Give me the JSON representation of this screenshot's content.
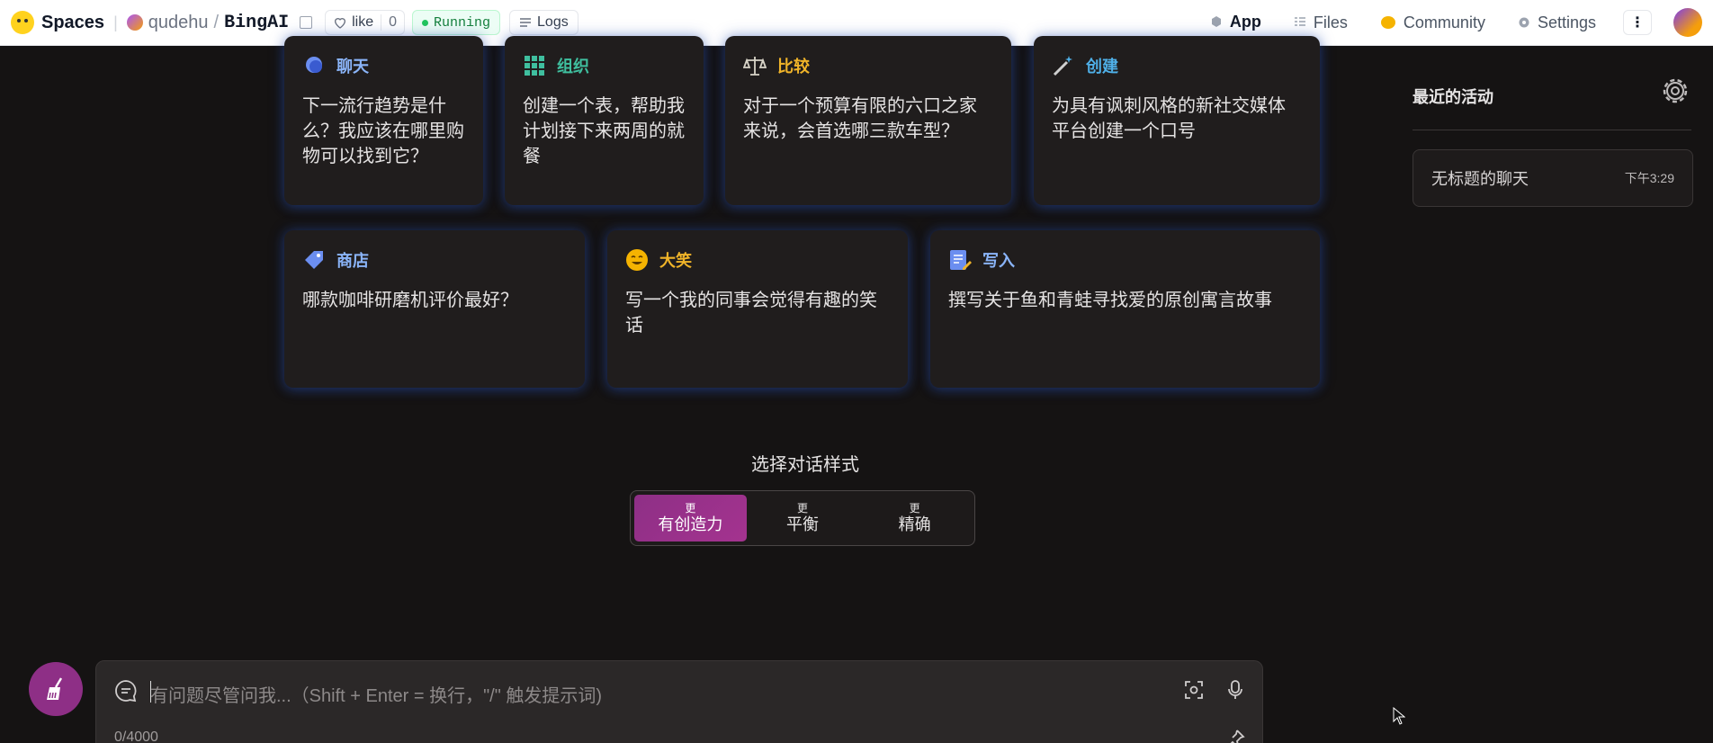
{
  "topbar": {
    "brand": "Spaces",
    "owner": "qudehu",
    "slash": "/",
    "repo": "BingAI",
    "like_label": "like",
    "like_count": "0",
    "status": "Running",
    "logs_label": "Logs",
    "nav": [
      {
        "label": "App",
        "icon": "cube-icon",
        "active": true
      },
      {
        "label": "Files",
        "icon": "files-icon"
      },
      {
        "label": "Community",
        "icon": "community-icon"
      },
      {
        "label": "Settings",
        "icon": "gear-icon"
      }
    ]
  },
  "cards": [
    {
      "title": "聊天",
      "text": "下一流行趋势是什么？我应该在哪里购物可以找到它？",
      "color": "#8ab4f8",
      "icon": "chat-bubble-icon"
    },
    {
      "title": "组织",
      "text": "创建一个表，帮助我计划接下来两周的就餐",
      "color": "#3fbf9f",
      "icon": "grid-icon"
    },
    {
      "title": "比较",
      "text": "对于一个预算有限的六口之家来说，会首选哪三款车型？",
      "color": "#f0b429",
      "icon": "scales-icon"
    },
    {
      "title": "创建",
      "text": "为具有讽刺风格的新社交媒体平台创建一个口号",
      "color": "#4fb0e8",
      "icon": "magic-wand-icon"
    },
    {
      "title": "商店",
      "text": "哪款咖啡研磨机评价最好？",
      "color": "#8ab4f8",
      "icon": "tag-icon"
    },
    {
      "title": "大笑",
      "text": "写一个我的同事会觉得有趣的笑话",
      "color": "#f0b429",
      "icon": "smile-icon"
    },
    {
      "title": "写入",
      "text": "撰写关于鱼和青蛙寻找爱的原创寓言故事",
      "color": "#8ab4f8",
      "icon": "note-icon"
    }
  ],
  "sidebar": {
    "title": "最近的活动",
    "chats": [
      {
        "title": "无标题的聊天",
        "time": "下午3:29"
      }
    ]
  },
  "style_selector": {
    "label": "选择对话样式",
    "options": [
      {
        "more": "更",
        "name": "有创造力",
        "active": true
      },
      {
        "more": "更",
        "name": "平衡"
      },
      {
        "more": "更",
        "name": "精确"
      }
    ]
  },
  "input": {
    "placeholder": "有问题尽管问我...（Shift + Enter = 换行，\"/\" 触发提示词)",
    "counter": "0/4000"
  },
  "colors": {
    "accent": "#8e2f86",
    "background": "#151313",
    "card": "#201d1d"
  }
}
